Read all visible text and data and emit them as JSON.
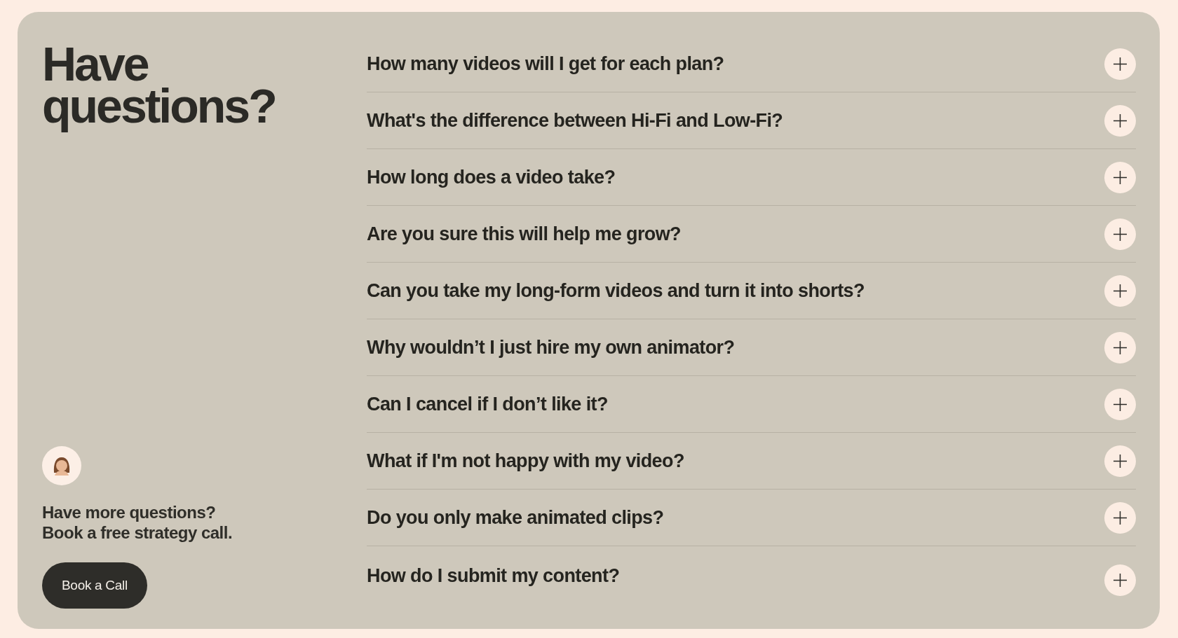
{
  "heading": "Have questions?",
  "faq": [
    {
      "question": "How many videos will I get for each plan?",
      "expanded": false
    },
    {
      "question": "What's the difference between Hi-Fi and Low-Fi?",
      "expanded": false
    },
    {
      "question": "How long does a video take?",
      "expanded": false
    },
    {
      "question": "Are you sure this will help me grow?",
      "expanded": false
    },
    {
      "question": "Can you take my long-form videos and turn it into shorts?",
      "expanded": false
    },
    {
      "question": "Why wouldn’t I just hire my own animator?",
      "expanded": false
    },
    {
      "question": "Can I cancel if I don’t like it?",
      "expanded": false
    },
    {
      "question": "What if I'm not happy with my video?",
      "expanded": false
    },
    {
      "question": "Do you only make animated clips?",
      "expanded": false
    },
    {
      "question": "How do I submit my content?",
      "expanded": false
    }
  ],
  "cta": {
    "lines": [
      "Have more questions?",
      "Book a free strategy call."
    ],
    "button": "Book a Call"
  }
}
